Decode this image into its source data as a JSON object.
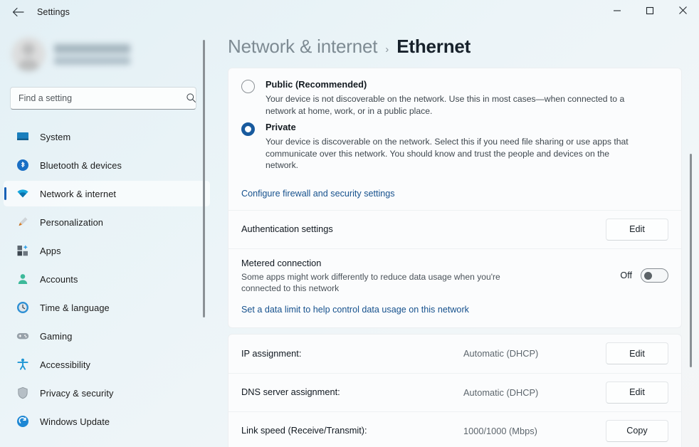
{
  "titlebar": {
    "back_icon": "arrow-left-icon",
    "app_title": "Settings",
    "minimize_icon": "minimize-icon",
    "maximize_icon": "maximize-icon",
    "close_icon": "close-icon"
  },
  "sidebar": {
    "profile": {
      "name": "                 ",
      "email": "                                   "
    },
    "search": {
      "placeholder": "Find a setting",
      "value": "",
      "icon": "search-icon"
    },
    "items": [
      {
        "label": "System",
        "icon": "display-icon",
        "active": false
      },
      {
        "label": "Bluetooth & devices",
        "icon": "bluetooth-icon",
        "active": false
      },
      {
        "label": "Network & internet",
        "icon": "wifi-icon",
        "active": true
      },
      {
        "label": "Personalization",
        "icon": "paintbrush-icon",
        "active": false
      },
      {
        "label": "Apps",
        "icon": "apps-grid-icon",
        "active": false
      },
      {
        "label": "Accounts",
        "icon": "person-icon",
        "active": false
      },
      {
        "label": "Time & language",
        "icon": "clock-icon",
        "active": false
      },
      {
        "label": "Gaming",
        "icon": "gamepad-icon",
        "active": false
      },
      {
        "label": "Accessibility",
        "icon": "accessibility-icon",
        "active": false
      },
      {
        "label": "Privacy & security",
        "icon": "shield-icon",
        "active": false
      },
      {
        "label": "Windows Update",
        "icon": "update-refresh-icon",
        "active": false
      }
    ]
  },
  "header": {
    "breadcrumb_parent": "Network & internet",
    "breadcrumb_separator": "›",
    "breadcrumb_current": "Ethernet"
  },
  "profile_section": {
    "options": [
      {
        "label": "Public (Recommended)",
        "description": "Your device is not discoverable on the network. Use this in most cases—when connected to a network at home, work, or in a public place.",
        "selected": false
      },
      {
        "label": "Private",
        "description": "Your device is discoverable on the network. Select this if you need file sharing or use apps that communicate over this network. You should know and trust the people and devices on the network.",
        "selected": true
      }
    ],
    "firewall_link": "Configure firewall and security settings"
  },
  "settings_rows": {
    "authentication": {
      "title": "Authentication settings",
      "button": "Edit"
    },
    "metered": {
      "title": "Metered connection",
      "description": "Some apps might work differently to reduce data usage when you're connected to this network",
      "toggle_label": "Off",
      "toggle_on": false
    },
    "data_limit_link": "Set a data limit to help control data usage on this network"
  },
  "details": [
    {
      "label": "IP assignment:",
      "value": "Automatic (DHCP)",
      "button": "Edit"
    },
    {
      "label": "DNS server assignment:",
      "value": "Automatic (DHCP)",
      "button": "Edit"
    },
    {
      "label": "Link speed (Receive/Transmit):",
      "value": "1000/1000 (Mbps)",
      "button": "Copy"
    }
  ],
  "colors": {
    "accent": "#1761b6",
    "radio_selected": "#185a9e",
    "link": "#16518d",
    "card_bg": "#fbfcfd"
  }
}
